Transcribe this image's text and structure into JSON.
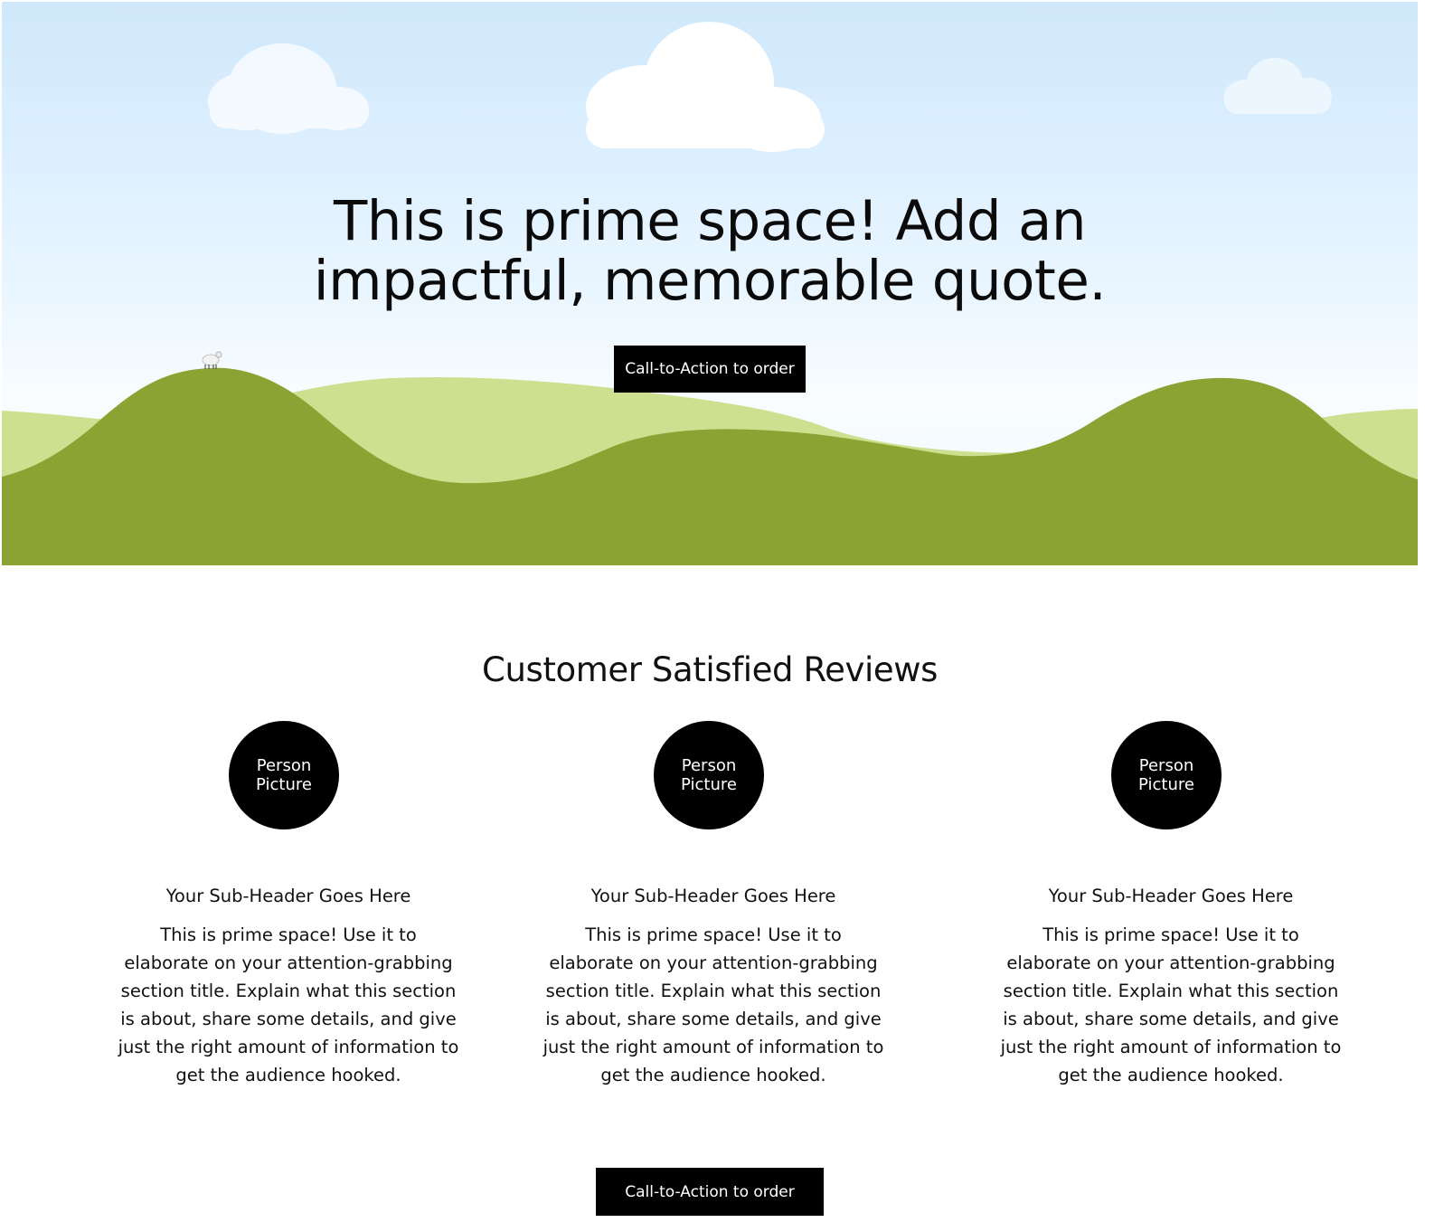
{
  "hero": {
    "title_lines": [
      "This is prime space! Add an",
      "impactful, memorable quote."
    ],
    "cta_label": "Call-to-Action to order",
    "colors": {
      "sky_top": "#cfe8fa",
      "hill_light": "#cce08f",
      "hill_dark": "#8ba332",
      "cloud": "#ffffff"
    }
  },
  "reviews": {
    "title": "Customer Satisfied Reviews",
    "items": [
      {
        "avatar_label": "Person\nPicture",
        "subheader": "Your Sub-Header Goes Here",
        "body": "This is prime space! Use it to elaborate on your attention-grabbing section title. Explain what this section is about, share some details, and give just the right amount of information to get the audience hooked."
      },
      {
        "avatar_label": "Person\nPicture",
        "subheader": "Your Sub-Header Goes Here",
        "body": "This is prime space! Use it to elaborate on your attention-grabbing section title. Explain what this section is about, share some details, and give just the right amount of information to get the audience hooked."
      },
      {
        "avatar_label": "Person\nPicture",
        "subheader": "Your Sub-Header Goes Here",
        "body": "This is prime space! Use it to elaborate on your attention-grabbing section title. Explain what this section is about, share some details, and give just the right amount of information to get the audience hooked."
      }
    ],
    "cta_label": "Call-to-Action to order"
  }
}
